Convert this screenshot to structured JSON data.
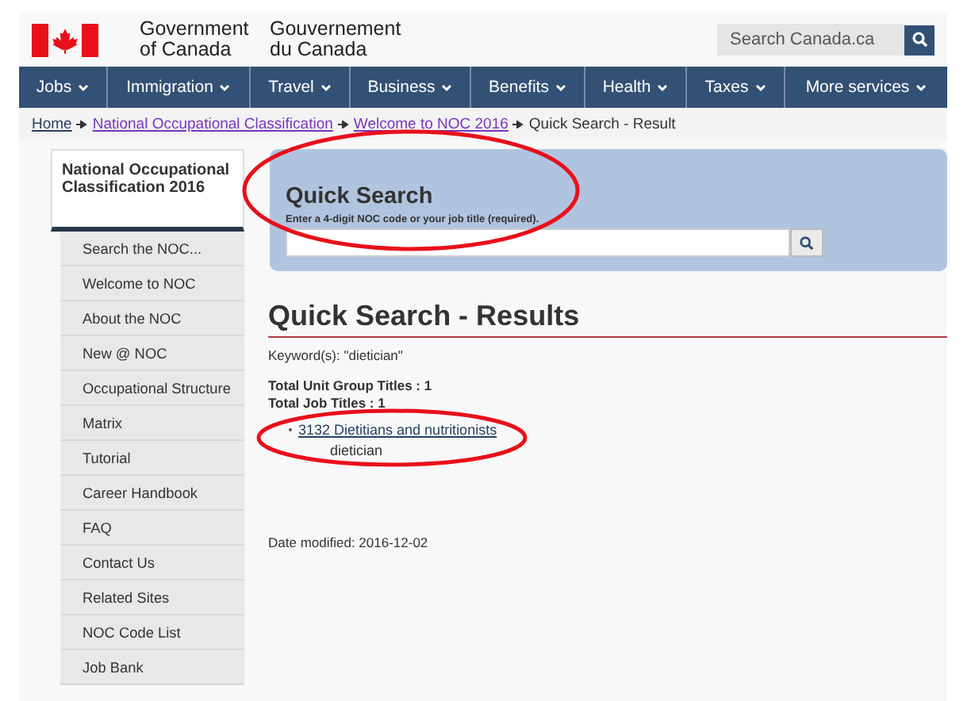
{
  "header": {
    "name_en": [
      "Government",
      "of Canada"
    ],
    "name_fr": [
      "Gouvernement",
      "du Canada"
    ],
    "search": {
      "placeholder": "Search Canada.ca"
    }
  },
  "nav": [
    {
      "label": "Jobs"
    },
    {
      "label": "Immigration"
    },
    {
      "label": "Travel"
    },
    {
      "label": "Business"
    },
    {
      "label": "Benefits"
    },
    {
      "label": "Health"
    },
    {
      "label": "Taxes"
    },
    {
      "label": "More services"
    }
  ],
  "breadcrumb": {
    "links": [
      "Home",
      "National Occupational Classification",
      "Welcome to NOC 2016"
    ],
    "current": "Quick Search - Result"
  },
  "sidebar": {
    "title": "National Occupational Classification 2016",
    "items": [
      "Search the NOC...",
      "Welcome to NOC",
      "About the NOC",
      "New @ NOC",
      "Occupational Structure",
      "Matrix",
      "Tutorial",
      "Career Handbook",
      "FAQ",
      "Contact Us",
      "Related Sites",
      "NOC Code List",
      "Job Bank"
    ]
  },
  "quick_search": {
    "title": "Quick Search",
    "hint": "Enter a 4-digit NOC code or your job title (required).",
    "circled": true
  },
  "results": {
    "title": "Quick Search - Results",
    "keyword": "Keyword(s): \"dietician\"",
    "totals": [
      "Total Unit Group Titles : 1",
      "Total Job Titles : 1"
    ],
    "items": [
      {
        "link": "3132 Dietitians and nutritionists",
        "match": "dietician",
        "circled": true
      }
    ]
  },
  "date_modified": "Date modified: 2016-12-02"
}
